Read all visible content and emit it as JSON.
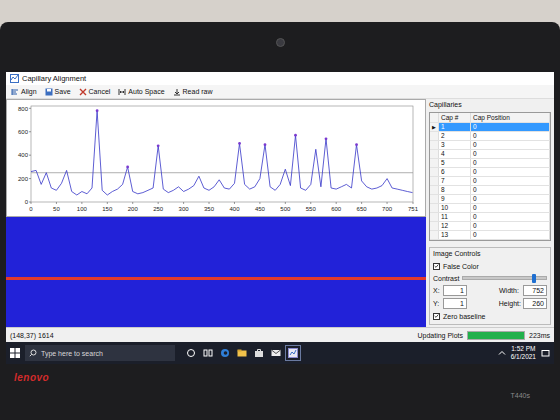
{
  "window": {
    "title": "Capillary Alignment"
  },
  "toolbar": [
    {
      "label": "Align"
    },
    {
      "label": "Save"
    },
    {
      "label": "Cancel"
    },
    {
      "label": "Auto Space"
    },
    {
      "label": "Read raw"
    }
  ],
  "chart": {
    "y_ticks": [
      "0",
      "200",
      "400",
      "600",
      "800"
    ],
    "x_ticks": [
      "0",
      "50",
      "100",
      "150",
      "200",
      "250",
      "300",
      "350",
      "400",
      "450",
      "500",
      "550",
      "600",
      "650",
      "700",
      "751"
    ],
    "x_step": 10,
    "values": [
      260,
      270,
      150,
      250,
      120,
      100,
      160,
      270,
      90,
      60,
      90,
      70,
      120,
      780,
      100,
      60,
      90,
      110,
      150,
      300,
      90,
      70,
      80,
      100,
      120,
      480,
      110,
      80,
      100,
      130,
      90,
      110,
      140,
      220,
      120,
      100,
      130,
      190,
      120,
      110,
      160,
      500,
      150,
      110,
      130,
      200,
      490,
      130,
      100,
      150,
      280,
      140,
      570,
      120,
      100,
      150,
      450,
      130,
      540,
      120,
      110,
      130,
      150,
      120,
      490,
      180,
      130,
      110,
      120,
      140,
      200,
      120,
      110,
      100,
      90,
      80
    ],
    "threshold": 250,
    "peaks_x": [
      130,
      190,
      250,
      410,
      460,
      520,
      580,
      640
    ]
  },
  "capillaries": {
    "title": "Capillaries",
    "pointer": "▶",
    "columns": [
      "Cap #",
      "Cap Position"
    ],
    "rows": [
      {
        "cap": "1",
        "position": "0",
        "selected": true
      },
      {
        "cap": "2",
        "position": "0",
        "selected": false
      },
      {
        "cap": "3",
        "position": "0",
        "selected": false
      },
      {
        "cap": "4",
        "position": "0",
        "selected": false
      },
      {
        "cap": "5",
        "position": "0",
        "selected": false
      },
      {
        "cap": "6",
        "position": "0",
        "selected": false
      },
      {
        "cap": "7",
        "position": "0",
        "selected": false
      },
      {
        "cap": "8",
        "position": "0",
        "selected": false
      },
      {
        "cap": "9",
        "position": "0",
        "selected": false
      },
      {
        "cap": "10",
        "position": "0",
        "selected": false
      },
      {
        "cap": "11",
        "position": "0",
        "selected": false
      },
      {
        "cap": "12",
        "position": "0",
        "selected": false
      },
      {
        "cap": "13",
        "position": "0",
        "selected": false
      }
    ]
  },
  "image_controls": {
    "title": "Image Controls",
    "false_color": {
      "label": "False Color",
      "checked": true
    },
    "contrast": {
      "label": "Contrast",
      "level": 0.85
    },
    "x": {
      "label": "X:",
      "value": "1"
    },
    "y": {
      "label": "Y:",
      "value": "1"
    },
    "width": {
      "label": "Width:",
      "value": "752"
    },
    "height": {
      "label": "Height:",
      "value": "260"
    },
    "zero_baseline": {
      "label": "Zero baseline",
      "checked": true
    }
  },
  "status_bar": {
    "coords": "(148,37) 1614",
    "task": "Updating Plots",
    "progress": 1,
    "time": "223ms"
  },
  "taskbar": {
    "search_placeholder": "Type here to search",
    "time": "1:52 PM",
    "date": "6/1/2021"
  },
  "laptop": {
    "brand": "lenovo",
    "model": "T440s"
  }
}
